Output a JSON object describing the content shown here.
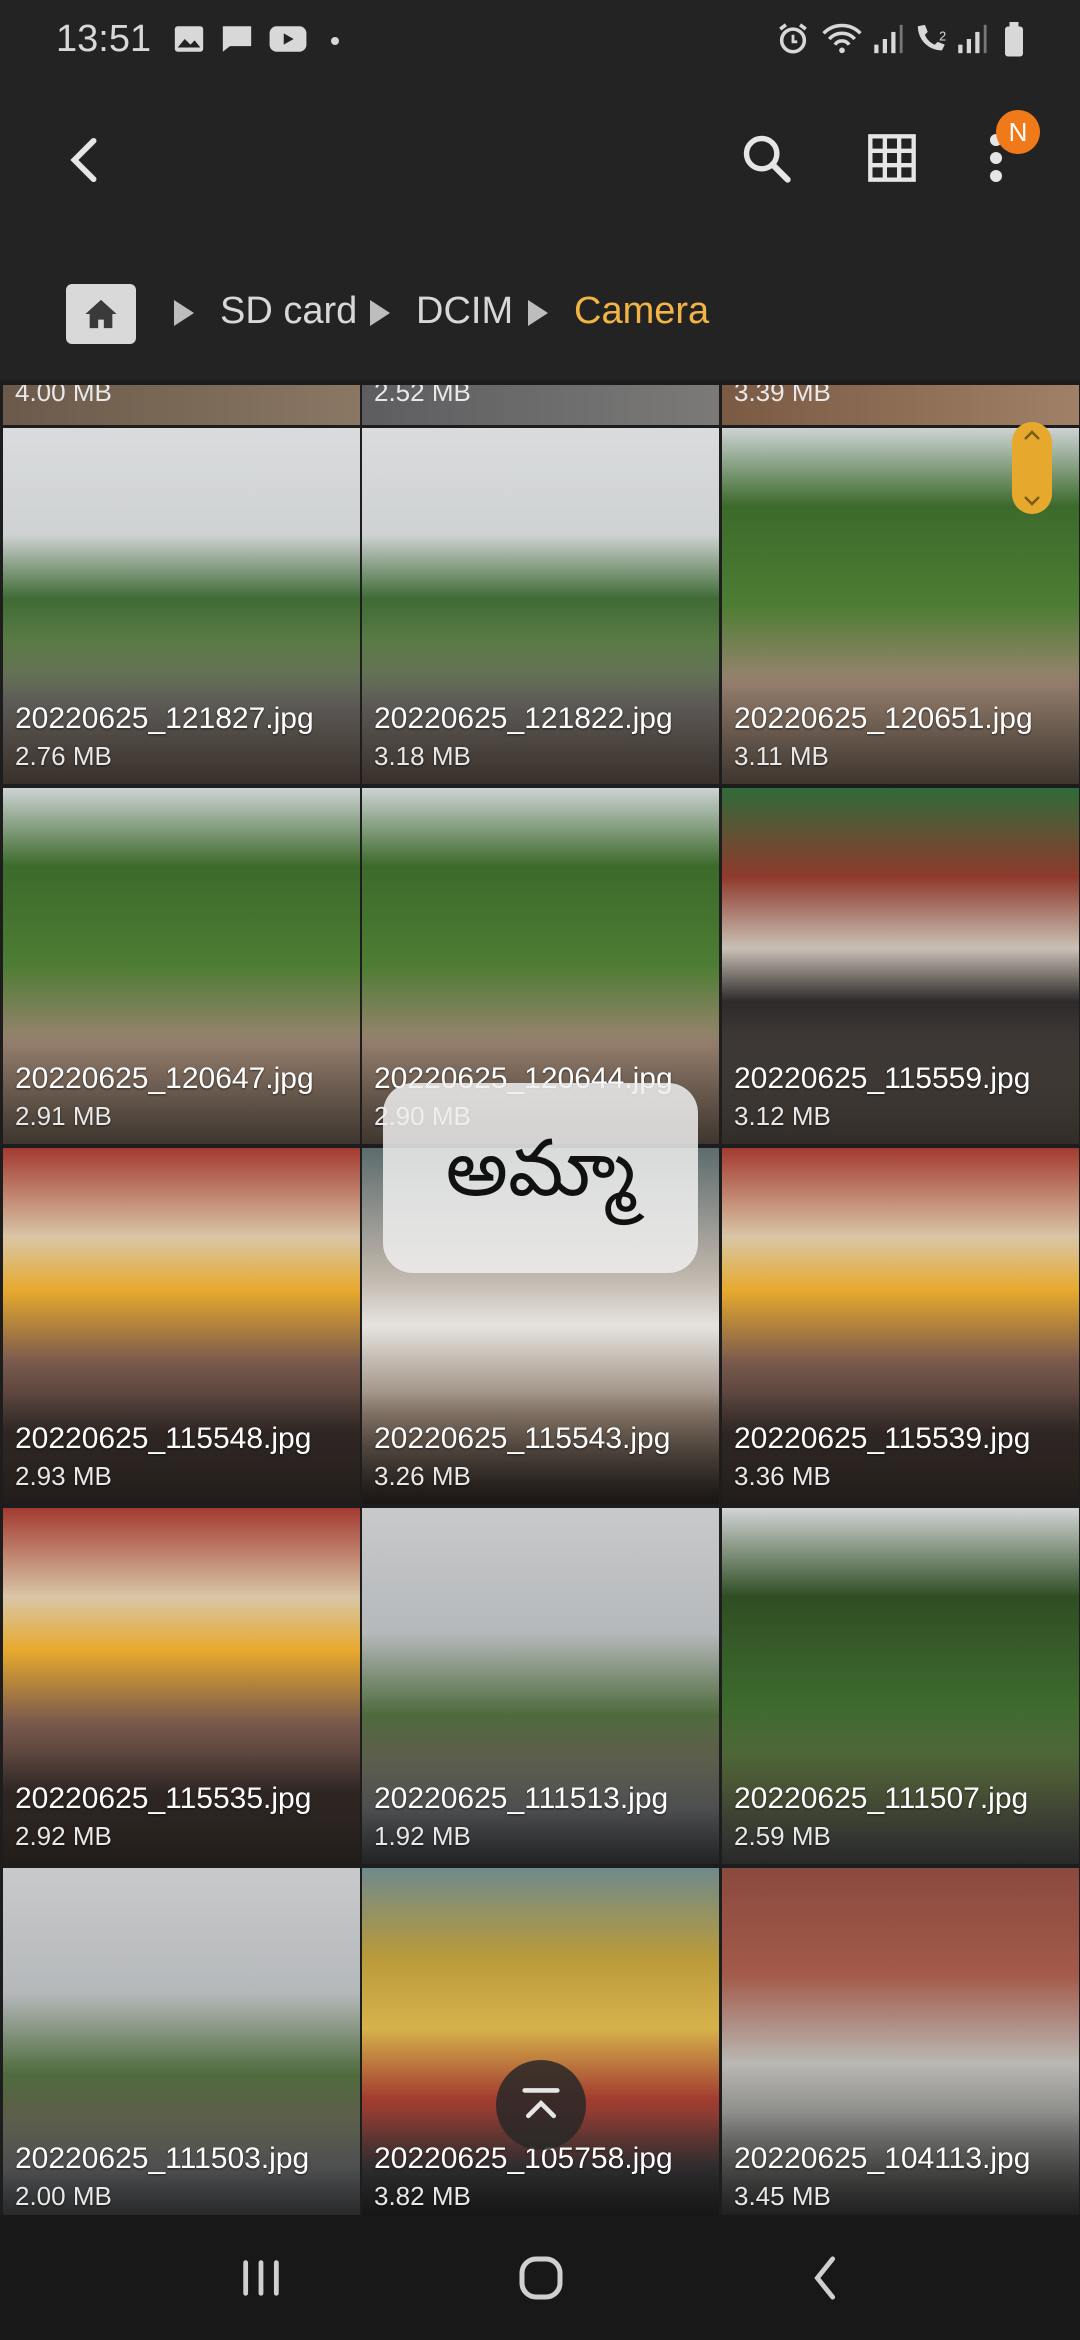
{
  "status_bar": {
    "time": "13:51",
    "icons": [
      "image-icon",
      "message-icon",
      "youtube-icon",
      "dot-icon",
      "alarm-icon",
      "wifi-icon",
      "signal-icon",
      "call-signal-icon",
      "signal2-icon",
      "battery-icon"
    ]
  },
  "app_bar": {
    "back_icon": "back-arrow-icon",
    "search_icon": "search-icon",
    "view_icon": "grid-view-icon",
    "more_icon": "more-vert-icon",
    "badge": "N"
  },
  "breadcrumb": {
    "home_icon": "home-icon",
    "items": [
      "SD card",
      "DCIM",
      "Camera"
    ]
  },
  "partial_row": [
    "4.00 MB",
    "2.52 MB",
    "3.39 MB"
  ],
  "files": [
    {
      "name": "20220625_121827.jpg",
      "size": "2.76 MB",
      "theme": "temple"
    },
    {
      "name": "20220625_121822.jpg",
      "size": "3.18 MB",
      "theme": "temple"
    },
    {
      "name": "20220625_120651.jpg",
      "size": "3.11 MB",
      "theme": "tree"
    },
    {
      "name": "20220625_120647.jpg",
      "size": "2.91 MB",
      "theme": "tree"
    },
    {
      "name": "20220625_120644.jpg",
      "size": "2.90 MB",
      "theme": "tree"
    },
    {
      "name": "20220625_115559.jpg",
      "size": "3.12 MB",
      "theme": "cow"
    },
    {
      "name": "20220625_115548.jpg",
      "size": "2.93 MB",
      "theme": "shrine"
    },
    {
      "name": "20220625_115543.jpg",
      "size": "3.26 MB",
      "theme": "cow2"
    },
    {
      "name": "20220625_115539.jpg",
      "size": "3.36 MB",
      "theme": "shrine"
    },
    {
      "name": "20220625_115535.jpg",
      "size": "2.92 MB",
      "theme": "shrine"
    },
    {
      "name": "20220625_111513.jpg",
      "size": "1.92 MB",
      "theme": "road"
    },
    {
      "name": "20220625_111507.jpg",
      "size": "2.59 MB",
      "theme": "bigtree"
    },
    {
      "name": "20220625_111503.jpg",
      "size": "2.00 MB",
      "theme": "road"
    },
    {
      "name": "20220625_105758.jpg",
      "size": "3.82 MB",
      "theme": "gold"
    },
    {
      "name": "20220625_104113.jpg",
      "size": "3.45 MB",
      "theme": "street"
    }
  ],
  "overlay_text": "అమ్మా",
  "nav_bar": [
    "recents-icon",
    "home-icon",
    "back-icon"
  ]
}
